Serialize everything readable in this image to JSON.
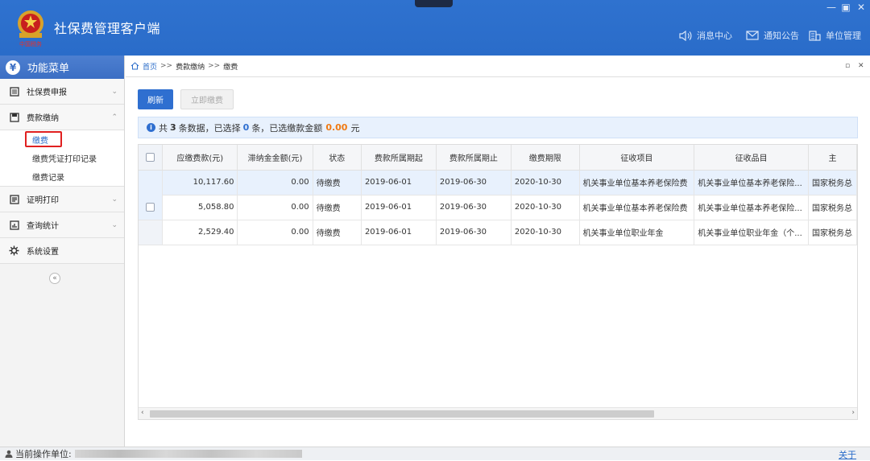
{
  "app": {
    "title": "社保费管理客户端",
    "logo_text": "中国税务"
  },
  "window": {
    "minimize": "—",
    "restore": "▣",
    "close": "✕"
  },
  "topnav": [
    {
      "label": "消息中心",
      "icon": "speaker-icon"
    },
    {
      "label": "通知公告",
      "icon": "mail-icon"
    },
    {
      "label": "单位管理",
      "icon": "building-icon"
    }
  ],
  "sidebar": {
    "header": "功能菜单",
    "items": [
      {
        "label": "社保费申报",
        "icon": "document-icon",
        "chevron": "⌄"
      },
      {
        "label": "费款缴纳",
        "icon": "card-icon",
        "chevron": "⌃",
        "children": [
          {
            "label": "缴费",
            "active": true
          },
          {
            "label": "缴费凭证打印记录"
          },
          {
            "label": "缴费记录"
          }
        ]
      },
      {
        "label": "证明打印",
        "icon": "print-icon",
        "chevron": "⌄"
      },
      {
        "label": "查询统计",
        "icon": "chart-icon",
        "chevron": "⌄"
      },
      {
        "label": "系统设置",
        "icon": "gear-icon"
      }
    ],
    "collapse": "«"
  },
  "breadcrumb": {
    "home": "首页",
    "sep": ">>",
    "level2": "费款缴纳",
    "level3": "缴费"
  },
  "toolbar": {
    "refresh": "刷新",
    "pay_now": "立即缴费"
  },
  "info_bar": {
    "prefix": "共",
    "total": "3",
    "mid1": "条数据，已选择",
    "selected": "0",
    "mid2": "条，已选缴款金额",
    "amount": "0.00",
    "suffix": "元"
  },
  "table": {
    "columns": [
      "应缴费款(元)",
      "滞纳金金额(元)",
      "状态",
      "费款所属期起",
      "费款所属期止",
      "缴费期限",
      "征收项目",
      "征收品目",
      "主"
    ],
    "rows": [
      [
        "10,117.60",
        "0.00",
        "待缴费",
        "2019-06-01",
        "2019-06-30",
        "2020-10-30",
        "机关事业单位基本养老保险费",
        "机关事业单位基本养老保险...",
        "国家税务总"
      ],
      [
        "5,058.80",
        "0.00",
        "待缴费",
        "2019-06-01",
        "2019-06-30",
        "2020-10-30",
        "机关事业单位基本养老保险费",
        "机关事业单位基本养老保险...",
        "国家税务总"
      ],
      [
        "2,529.40",
        "0.00",
        "待缴费",
        "2019-06-01",
        "2019-06-30",
        "2020-10-30",
        "机关事业单位职业年金",
        "机关事业单位职业年金（个...",
        "国家税务总"
      ]
    ]
  },
  "statusbar": {
    "label": "当前操作单位:",
    "about": "关于"
  },
  "colors": {
    "primary": "#2f6fd0",
    "titlebar": "#2a6cc9",
    "highlight": "#f07a14",
    "selected_row": "#e8f1fd",
    "active_box": "#e02020"
  }
}
